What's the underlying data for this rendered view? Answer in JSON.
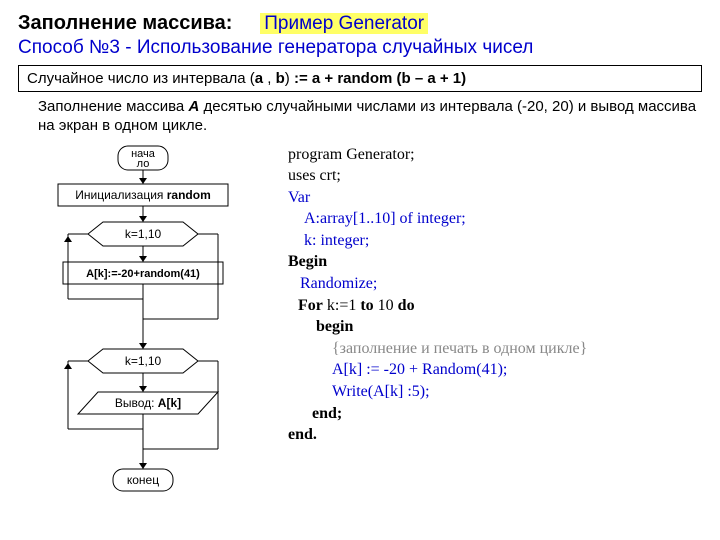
{
  "title_main": "Заполнение массива:",
  "title_ex": "Пример Generator",
  "subtitle": "Способ №3 - Использование генератора случайных чисел",
  "formula_parts": {
    "p1": "Случайное число из интервала (",
    "a": "a",
    "comma": " , ",
    "b": "b",
    "p2": ") ",
    "eq": " := a + random (b – a + 1)"
  },
  "desc_parts": {
    "p1": "Заполнение массива ",
    "A": "А",
    "p2": " десятью случайными числами из интервала (-20, 20) и вывод массива на экран в одном цикле."
  },
  "flow": {
    "start": "нача\nло",
    "init": "Инициализация",
    "init_bold": "random",
    "loop1": "k=1,10",
    "assign": "A[k]:=-20+random(41)",
    "loop2": "k=1,10",
    "output_pre": "Вывод: ",
    "output_bold": "A[k]",
    "end": "конец"
  },
  "code": {
    "l1": "program Generator;",
    "l2": "uses crt;",
    "l3": "Var",
    "l4": "A:array[1..10] of integer;",
    "l5": "k: integer;",
    "l6": "Begin",
    "l7": "Randomize;",
    "l8_for": "For",
    "l8_mid": " k:=1 ",
    "l8_to": "to",
    "l8_n": " 10 ",
    "l8_do": "do",
    "l9": "begin",
    "l10": "{заполнение и печать в одном цикле}",
    "l11": "A[k] := -20 + Random(41);",
    "l12": "Write(A[k] :5);",
    "l13": "end;",
    "l14": "end."
  }
}
